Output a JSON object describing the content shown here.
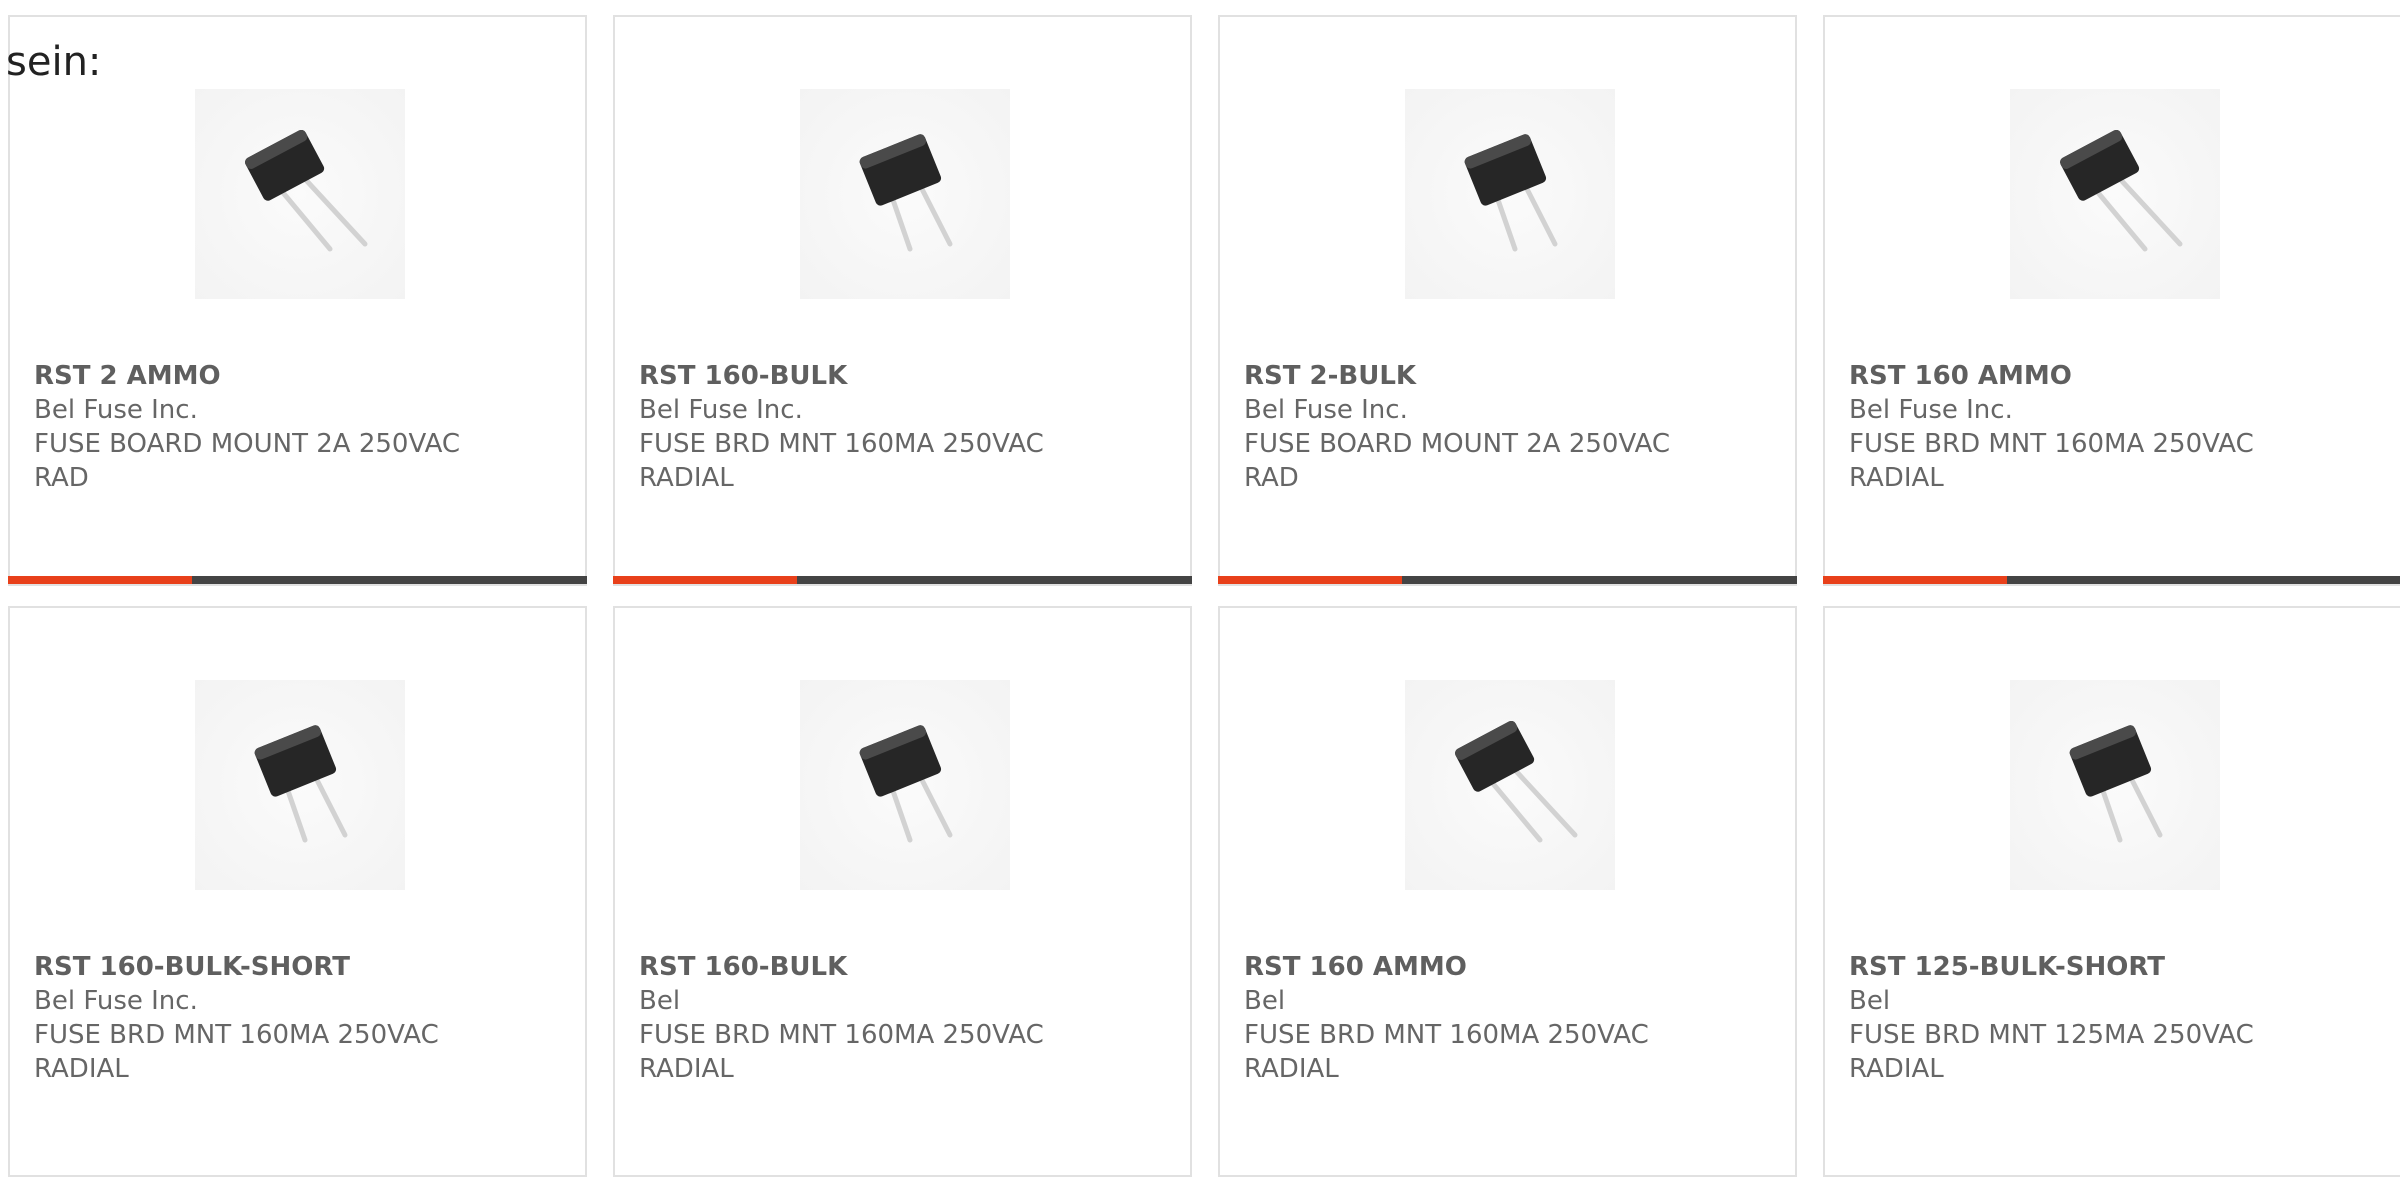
{
  "intro_text": "sein:",
  "colors": {
    "accent_orange": "#e8401a",
    "accent_dark": "#444444",
    "text_gray": "#666666",
    "card_border": "#e1e1e1"
  },
  "products": [
    {
      "part": "RST 2 AMMO",
      "maker": "Bel Fuse Inc.",
      "desc1": "FUSE BOARD MOUNT 2A 250VAC",
      "desc2": "RAD",
      "image": "fuse-component-icon"
    },
    {
      "part": "RST 160-BULK",
      "maker": "Bel Fuse Inc.",
      "desc1": "FUSE BRD MNT 160MA 250VAC",
      "desc2": "RADIAL",
      "image": "fuse-component-icon"
    },
    {
      "part": "RST 2-BULK",
      "maker": "Bel Fuse Inc.",
      "desc1": "FUSE BOARD MOUNT 2A 250VAC",
      "desc2": "RAD",
      "image": "fuse-component-icon"
    },
    {
      "part": "RST 160 AMMO",
      "maker": "Bel Fuse Inc.",
      "desc1": "FUSE BRD MNT 160MA 250VAC",
      "desc2": "RADIAL",
      "image": "fuse-component-icon"
    },
    {
      "part": "RST 160-BULK-SHORT",
      "maker": "Bel Fuse Inc.",
      "desc1": "FUSE BRD MNT 160MA 250VAC",
      "desc2": "RADIAL",
      "image": "fuse-component-icon"
    },
    {
      "part": "RST 160-BULK",
      "maker": "Bel",
      "desc1": "FUSE BRD MNT 160MA 250VAC",
      "desc2": "RADIAL",
      "image": "fuse-component-icon"
    },
    {
      "part": "RST 160 AMMO",
      "maker": "Bel",
      "desc1": "FUSE BRD MNT 160MA 250VAC",
      "desc2": "RADIAL",
      "image": "fuse-component-icon"
    },
    {
      "part": "RST 125-BULK-SHORT",
      "maker": "Bel",
      "desc1": "FUSE BRD MNT 125MA 250VAC",
      "desc2": "RADIAL",
      "image": "fuse-component-icon"
    }
  ]
}
